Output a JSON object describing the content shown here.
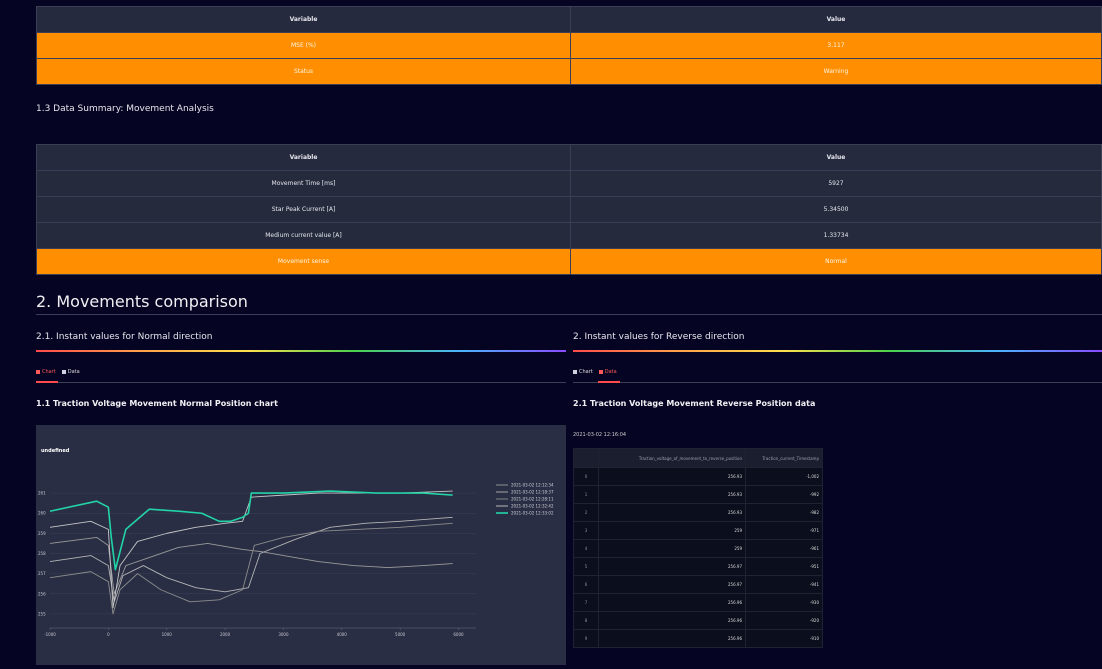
{
  "status_table": {
    "headers": [
      "Variable",
      "Value"
    ],
    "rows": [
      {
        "variable": "MSE (%)",
        "value": "3.117"
      },
      {
        "variable": "Status",
        "value": "Warning"
      }
    ]
  },
  "summary": {
    "title": "1.3 Data Summary: Movement Analysis",
    "headers": [
      "Variable",
      "Value"
    ],
    "rows": [
      {
        "variable": "Movement Time [ms]",
        "value": "5927"
      },
      {
        "variable": "Star Peak Current [A]",
        "value": "5.34500"
      },
      {
        "variable": "Medium current value [A]",
        "value": "1.33734"
      },
      {
        "variable": "Movement sense",
        "value": "Normal"
      }
    ]
  },
  "comparison": {
    "title": "2. Movements comparison",
    "left": {
      "subtitle": "2.1. Instant values for Normal direction",
      "tabs": [
        "Chart",
        "Data"
      ],
      "chart_title": "1.1 Traction Voltage Movement Normal Position chart"
    },
    "right": {
      "subtitle": "2. Instant values for Reverse direction",
      "tabs": [
        "Chart",
        "Data"
      ],
      "data_title": "2.1 Traction Voltage Movement Reverse Position data",
      "timestamp": "2021-03-02 12:16:04",
      "columns": [
        "",
        "Traction_voltage_of_movement_to_reverse_position",
        "Traction_current_Timestamp"
      ],
      "rows": [
        [
          "0",
          "256.93",
          "-1,002"
        ],
        [
          "1",
          "256.93",
          "-992"
        ],
        [
          "2",
          "256.93",
          "-982"
        ],
        [
          "3",
          "259",
          "-971"
        ],
        [
          "4",
          "259",
          "-961"
        ],
        [
          "5",
          "256.97",
          "-951"
        ],
        [
          "6",
          "256.97",
          "-941"
        ],
        [
          "7",
          "256.96",
          "-930"
        ],
        [
          "8",
          "256.96",
          "-920"
        ],
        [
          "9",
          "256.96",
          "-910"
        ]
      ]
    }
  },
  "chart_data": {
    "type": "line",
    "title": "undefined",
    "xlim": [
      -1000,
      6300
    ],
    "ylim": [
      254.3,
      261.8
    ],
    "x_ticks": [
      "-1000",
      "0",
      "1000",
      "2000",
      "3000",
      "4000",
      "5000",
      "6000"
    ],
    "y_ticks": [
      "255",
      "256",
      "257",
      "258",
      "259",
      "260",
      "261"
    ],
    "series": [
      {
        "name": "2021-03-02 12:12:34",
        "color": "#9a9a9a",
        "x": [
          -1000,
          -200,
          0,
          100,
          300,
          700,
          1200,
          1700,
          2300,
          2600,
          3200,
          3600,
          4200,
          4800,
          5400,
          5900
        ],
        "y": [
          258.5,
          258.8,
          258.4,
          256.0,
          257.4,
          257.8,
          258.3,
          258.5,
          258.2,
          258.1,
          257.8,
          257.6,
          257.4,
          257.3,
          257.4,
          257.5
        ]
      },
      {
        "name": "2021-03-02 12:18:37",
        "color": "#b4b4b4",
        "x": [
          -1000,
          -300,
          0,
          100,
          250,
          600,
          1000,
          1500,
          2000,
          2400,
          2600,
          3200,
          3800,
          4400,
          5000,
          5900
        ],
        "y": [
          257.6,
          257.9,
          257.4,
          255.6,
          256.9,
          257.4,
          256.8,
          256.3,
          256.1,
          256.3,
          258.0,
          258.7,
          259.3,
          259.5,
          259.6,
          259.8
        ]
      },
      {
        "name": "2021-03-02 12:28:11",
        "color": "#8c8c8c",
        "x": [
          -1000,
          -300,
          0,
          80,
          200,
          500,
          900,
          1400,
          1900,
          2300,
          2500,
          3000,
          3600,
          4300,
          5000,
          5900
        ],
        "y": [
          256.8,
          257.1,
          256.6,
          255.0,
          256.2,
          257.0,
          256.2,
          255.6,
          255.7,
          256.2,
          258.4,
          258.8,
          259.1,
          259.2,
          259.3,
          259.5
        ]
      },
      {
        "name": "2021-03-02 12:32:42",
        "color": "#c6c6c6",
        "x": [
          -1000,
          -300,
          0,
          80,
          200,
          500,
          1000,
          1500,
          2000,
          2300,
          2450,
          3000,
          3600,
          4300,
          5000,
          5900
        ],
        "y": [
          259.3,
          259.6,
          259.2,
          255.3,
          257.4,
          258.6,
          259.0,
          259.3,
          259.5,
          259.6,
          260.8,
          260.9,
          261.0,
          261.0,
          261.0,
          261.1
        ]
      },
      {
        "name": "2021-03-02 12:33:02",
        "color": "#22d3a6",
        "x": [
          -1000,
          -200,
          0,
          50,
          120,
          300,
          700,
          1200,
          1600,
          1900,
          2100,
          2300,
          2400,
          2450,
          3000,
          3800,
          4600,
          5400,
          5900
        ],
        "y": [
          260.1,
          260.6,
          260.3,
          258.8,
          257.2,
          259.2,
          260.2,
          260.1,
          260.0,
          259.6,
          259.6,
          259.8,
          260.0,
          261.0,
          261.0,
          261.1,
          261.0,
          261.0,
          260.9
        ]
      }
    ]
  }
}
